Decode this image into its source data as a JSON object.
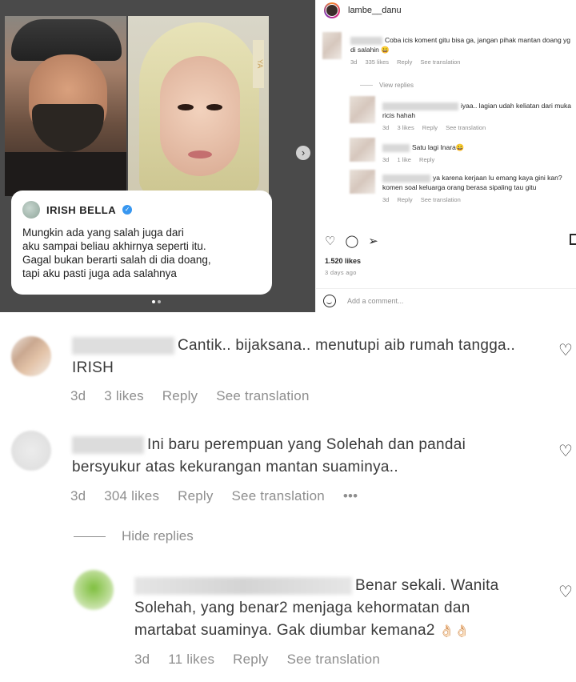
{
  "post": {
    "quote_name": "IRISH BELLA",
    "quote_lines": [
      "Mungkin ada yang salah juga dari",
      "aku sampai beliau akhirnya seperti itu.",
      "Gagal bukan berarti salah di dia doang,",
      "tapi aku pasti juga ada salahnya"
    ],
    "badge_text": "YA",
    "next_icon": "chevron-right-icon"
  },
  "panel": {
    "username": "lambe__danu",
    "comments": [
      {
        "text": "Coba icis koment gitu bisa ga, jangan pihak mantan doang yg di salahin 😀",
        "time": "3d",
        "likes": "335 likes",
        "reply": "Reply",
        "translate": "See translation"
      },
      {
        "text": "iyaa.. lagian udah keliatan dari muka ricis hahah",
        "time": "3d",
        "likes": "3 likes",
        "reply": "Reply",
        "translate": "See translation"
      },
      {
        "text": "Satu lagi Inara😀",
        "time": "3d",
        "likes": "1 like",
        "reply": "Reply",
        "translate": ""
      },
      {
        "text": "ya karena kerjaan lu emang kaya gini kan? komen soal keluarga orang berasa sipaling tau gitu",
        "time": "3d",
        "likes": "",
        "reply": "Reply",
        "translate": "See translation"
      }
    ],
    "view_replies": "View replies",
    "likes_count": "1.520 likes",
    "post_date": "3 days ago",
    "add_comment_placeholder": "Add a comment..."
  },
  "comments": [
    {
      "text_line1": "Cantik.. bijaksana.. menutupi aib rumah tangga..",
      "text_line2": "IRISH",
      "time": "3d",
      "likes": "3 likes",
      "reply": "Reply",
      "translate": "See translation"
    },
    {
      "text_line1": "Ini baru perempuan yang Solehah dan pandai",
      "text_line2": "bersyukur atas kekurangan mantan suaminya..",
      "time": "3d",
      "likes": "304 likes",
      "reply": "Reply",
      "translate": "See translation",
      "more": "•••"
    },
    {
      "hide_replies": "Hide replies"
    },
    {
      "text_line1": "Benar sekali. Wanita",
      "text_line2": "Solehah, yang benar2 menjaga kehormatan dan",
      "text_line3": "martabat suaminya. Gak diumbar kemana2",
      "emoji": "👌🏻👌🏻",
      "time": "3d",
      "likes": "11 likes",
      "reply": "Reply",
      "translate": "See translation"
    }
  ],
  "colors": {
    "text": "#262626",
    "muted": "#8e8e8e",
    "verified": "#3897f0"
  }
}
